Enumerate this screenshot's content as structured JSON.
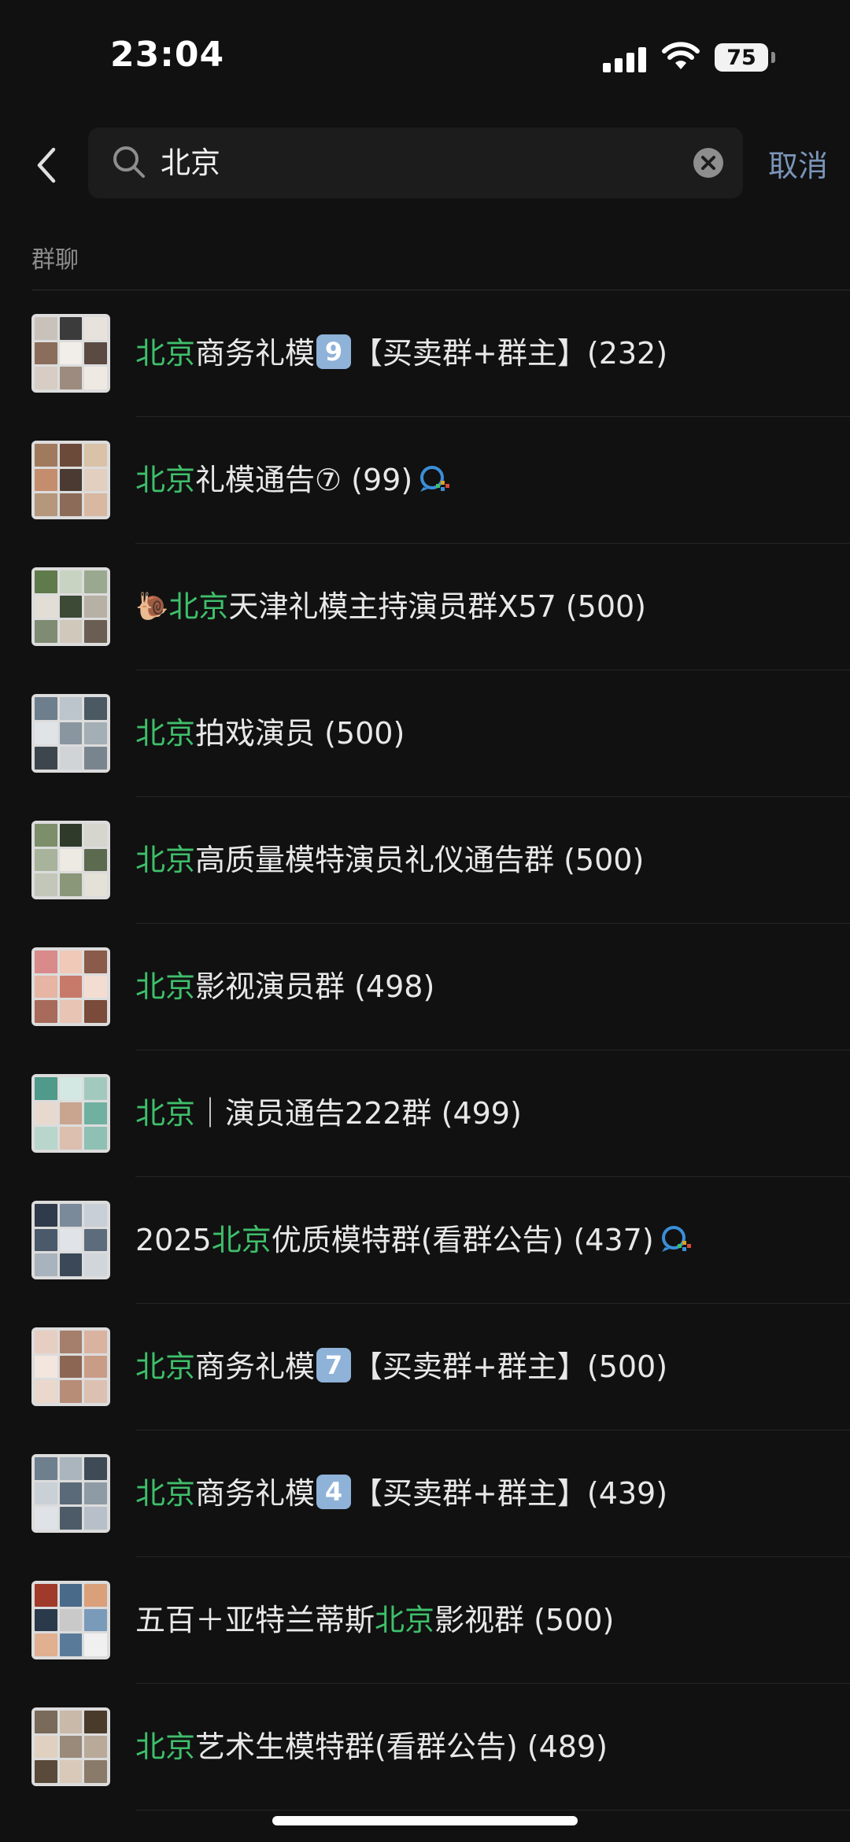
{
  "status_bar": {
    "time": "23:04",
    "battery": "75"
  },
  "search": {
    "query": "北京",
    "cancel_label": "取消"
  },
  "section": {
    "title": "群聊"
  },
  "colors": {
    "highlight": "#3fbf6b",
    "cancel": "#7b94b8",
    "badge": "#8fb2d8"
  },
  "groups": [
    {
      "pre": "",
      "hl": "北京",
      "mid": "商务礼模",
      "badge": "9",
      "post": "【买卖群+群主】(232)",
      "chat_icon": false,
      "snail": false
    },
    {
      "pre": "",
      "hl": "北京",
      "mid": "礼模通告⑦ (99)",
      "badge": "",
      "post": "",
      "chat_icon": true,
      "snail": false
    },
    {
      "pre": "",
      "hl": "北京",
      "mid": "天津礼模主持演员群X57 (500)",
      "badge": "",
      "post": "",
      "chat_icon": false,
      "snail": true
    },
    {
      "pre": "",
      "hl": "北京",
      "mid": "拍戏演员 (500)",
      "badge": "",
      "post": "",
      "chat_icon": false,
      "snail": false
    },
    {
      "pre": "",
      "hl": "北京",
      "mid": "高质量模特演员礼仪通告群 (500)",
      "badge": "",
      "post": "",
      "chat_icon": false,
      "snail": false
    },
    {
      "pre": "",
      "hl": "北京",
      "mid": "影视演员群 (498)",
      "badge": "",
      "post": "",
      "chat_icon": false,
      "snail": false
    },
    {
      "pre": "",
      "hl": "北京",
      "mid": "｜演员通告222群 (499)",
      "badge": "",
      "post": "",
      "chat_icon": false,
      "snail": false
    },
    {
      "pre": "2025",
      "hl": "北京",
      "mid": "优质模特群(看群公告) (437)",
      "badge": "",
      "post": "",
      "chat_icon": true,
      "snail": false
    },
    {
      "pre": "",
      "hl": "北京",
      "mid": "商务礼模",
      "badge": "7",
      "post": "【买卖群+群主】(500)",
      "chat_icon": false,
      "snail": false
    },
    {
      "pre": "",
      "hl": "北京",
      "mid": "商务礼模",
      "badge": "4",
      "post": "【买卖群+群主】(439)",
      "chat_icon": false,
      "snail": false
    },
    {
      "pre": "五百＋亚特兰蒂斯",
      "hl": "北京",
      "mid": "影视群 (500)",
      "badge": "",
      "post": "",
      "chat_icon": false,
      "snail": false
    },
    {
      "pre": "",
      "hl": "北京",
      "mid": "艺术生模特群(看群公告) (489)",
      "badge": "",
      "post": "",
      "chat_icon": false,
      "snail": false
    }
  ]
}
